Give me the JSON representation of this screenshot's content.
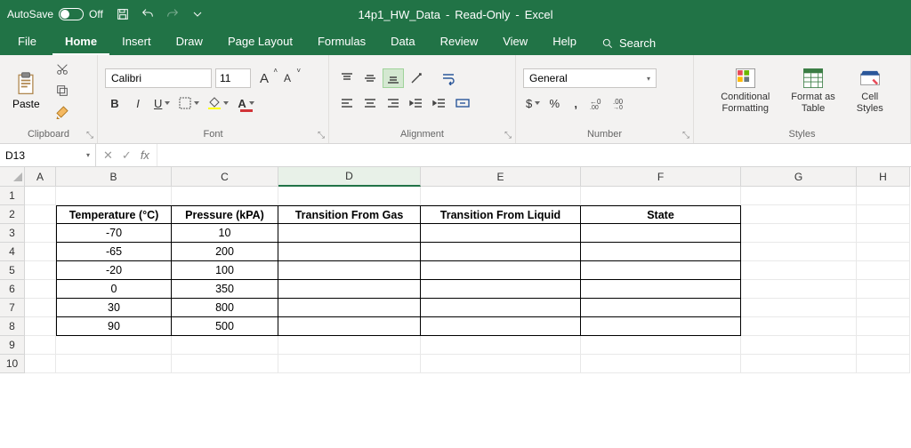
{
  "titlebar": {
    "autosave_label": "AutoSave",
    "autosave_state": "Off",
    "doc_name": "14p1_HW_Data",
    "mode": "Read-Only",
    "app": "Excel"
  },
  "tabs": {
    "file": "File",
    "home": "Home",
    "insert": "Insert",
    "draw": "Draw",
    "page_layout": "Page Layout",
    "formulas": "Formulas",
    "data": "Data",
    "review": "Review",
    "view": "View",
    "help": "Help",
    "search": "Search"
  },
  "ribbon": {
    "clipboard": {
      "paste": "Paste",
      "group": "Clipboard"
    },
    "font": {
      "name": "Calibri",
      "size": "11",
      "bold": "B",
      "italic": "I",
      "underline": "U",
      "group": "Font"
    },
    "alignment": {
      "group": "Alignment"
    },
    "number": {
      "format": "General",
      "group": "Number",
      "dollar": "$",
      "percent": "%",
      "comma": ","
    },
    "styles": {
      "conditional": "Conditional\nFormatting",
      "format_table": "Format as\nTable",
      "cell_styles": "Cell\nStyles",
      "group": "Styles"
    }
  },
  "fxbar": {
    "namebox": "D13",
    "fx": "fx"
  },
  "columns": [
    "A",
    "B",
    "C",
    "D",
    "E",
    "F",
    "G",
    "H"
  ],
  "active_column": "D",
  "row_count": 10,
  "selected_cell": {
    "row": 13,
    "col": "D"
  },
  "table": {
    "headers": [
      "Temperature (°C)",
      "Pressure (kPA)",
      "Transition From Gas",
      "Transition From Liquid",
      "State"
    ],
    "rows": [
      {
        "temp": "-70",
        "pressure": "10",
        "t_gas": "",
        "t_liq": "",
        "state": ""
      },
      {
        "temp": "-65",
        "pressure": "200",
        "t_gas": "",
        "t_liq": "",
        "state": ""
      },
      {
        "temp": "-20",
        "pressure": "100",
        "t_gas": "",
        "t_liq": "",
        "state": ""
      },
      {
        "temp": "0",
        "pressure": "350",
        "t_gas": "",
        "t_liq": "",
        "state": ""
      },
      {
        "temp": "30",
        "pressure": "800",
        "t_gas": "",
        "t_liq": "",
        "state": ""
      },
      {
        "temp": "90",
        "pressure": "500",
        "t_gas": "",
        "t_liq": "",
        "state": ""
      }
    ]
  }
}
